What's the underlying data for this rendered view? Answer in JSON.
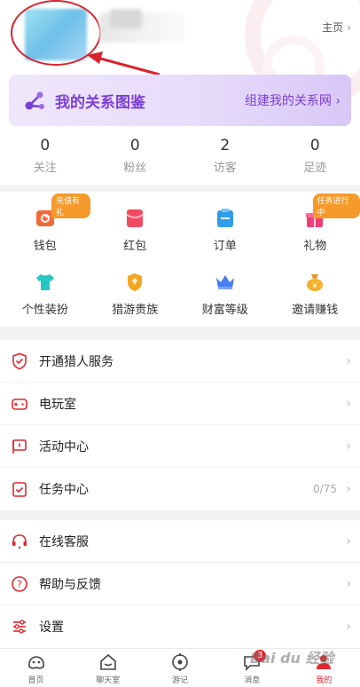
{
  "header": {
    "home_label": "主页",
    "banner_title": "我的关系图鉴",
    "banner_link": "组建我的关系网"
  },
  "stats": [
    {
      "value": "0",
      "label": "关注"
    },
    {
      "value": "0",
      "label": "粉丝"
    },
    {
      "value": "2",
      "label": "访客"
    },
    {
      "value": "0",
      "label": "足迹"
    }
  ],
  "grid": {
    "row1": [
      {
        "label": "钱包",
        "icon": "wallet-icon",
        "tag": "充值有礼"
      },
      {
        "label": "红包",
        "icon": "red-envelope-icon"
      },
      {
        "label": "订单",
        "icon": "order-icon"
      },
      {
        "label": "礼物",
        "icon": "gift-icon",
        "tag": "任务进行中"
      }
    ],
    "row2": [
      {
        "label": "个性装扮",
        "icon": "tshirt-icon"
      },
      {
        "label": "猎游贵族",
        "icon": "noble-badge-icon"
      },
      {
        "label": "财富等级",
        "icon": "crown-icon"
      },
      {
        "label": "邀请赚钱",
        "icon": "money-bag-icon"
      }
    ]
  },
  "menu1": [
    {
      "label": "开通猎人服务",
      "icon": "shield-check-icon"
    },
    {
      "label": "电玩室",
      "icon": "gamepad-icon"
    },
    {
      "label": "活动中心",
      "icon": "flag-icon"
    },
    {
      "label": "任务中心",
      "icon": "clipboard-check-icon",
      "value": "0/75"
    }
  ],
  "menu2": [
    {
      "label": "在线客服",
      "icon": "headset-icon"
    },
    {
      "label": "帮助与反馈",
      "icon": "question-icon"
    },
    {
      "label": "设置",
      "icon": "sliders-icon"
    }
  ],
  "tabbar": [
    {
      "label": "首页",
      "icon": "home-game-icon"
    },
    {
      "label": "聊天室",
      "icon": "chat-house-icon"
    },
    {
      "label": "游记",
      "icon": "compass-icon"
    },
    {
      "label": "消息",
      "icon": "message-icon",
      "badge": "3"
    },
    {
      "label": "我的",
      "icon": "profile-icon",
      "active": true
    }
  ],
  "watermark": "Bai du 经验",
  "colors": {
    "accent": "#e0272f",
    "purple": "#7b3fd6",
    "annotation": "#d9232e"
  }
}
